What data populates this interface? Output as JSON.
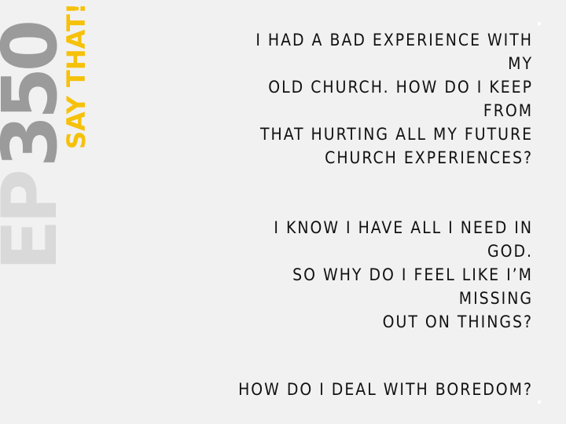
{
  "brand": {
    "episode_prefix": "EP",
    "episode_number": "350",
    "show_name": "SAY THAT!",
    "colors": {
      "prefix": "#d9d9d9",
      "number": "#9b9b9b",
      "show_name": "#f6c10a",
      "background": "#f1f1f1"
    }
  },
  "questions": [
    {
      "text": "I had a bad experience with my\nold church. How do I keep from\nthat hurting all my future\nchurch experiences?"
    },
    {
      "text": "I know I have all I need in God.\nSo why do I feel like I’m missing\nout on things?"
    },
    {
      "text": "How do I deal with boredom?"
    }
  ]
}
